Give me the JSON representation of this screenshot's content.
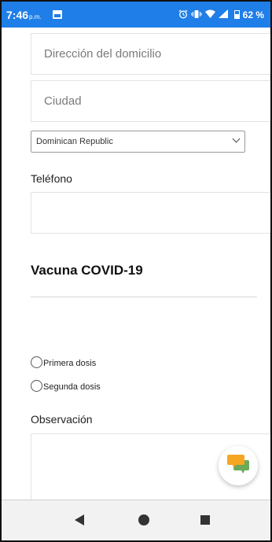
{
  "status_bar": {
    "time": "7:46",
    "ampm": "p.m.",
    "battery": "62 %",
    "icons": [
      "image-icon",
      "alarm-icon",
      "vibrate-icon",
      "wifi-icon",
      "signal-icon",
      "battery-icon"
    ],
    "background": "#1f7ee8"
  },
  "form": {
    "address_placeholder": "Dirección del domicilio",
    "city_placeholder": "Ciudad",
    "country_selected": "Dominican Republic",
    "phone_label": "Teléfono",
    "phone_value": "",
    "vaccine_title": "Vacuna COVID-19",
    "dose_options": [
      {
        "label": "Primera dosis",
        "selected": false
      },
      {
        "label": "Segunda dosis",
        "selected": false
      }
    ],
    "observation_label": "Observación"
  },
  "chat_button": {
    "icon": "chat-bubbles-icon",
    "colors": {
      "front": "#f5a623",
      "back": "#6aaa5a"
    }
  },
  "nav_bar": {
    "icons": [
      "back-icon",
      "home-icon",
      "recents-icon"
    ]
  }
}
